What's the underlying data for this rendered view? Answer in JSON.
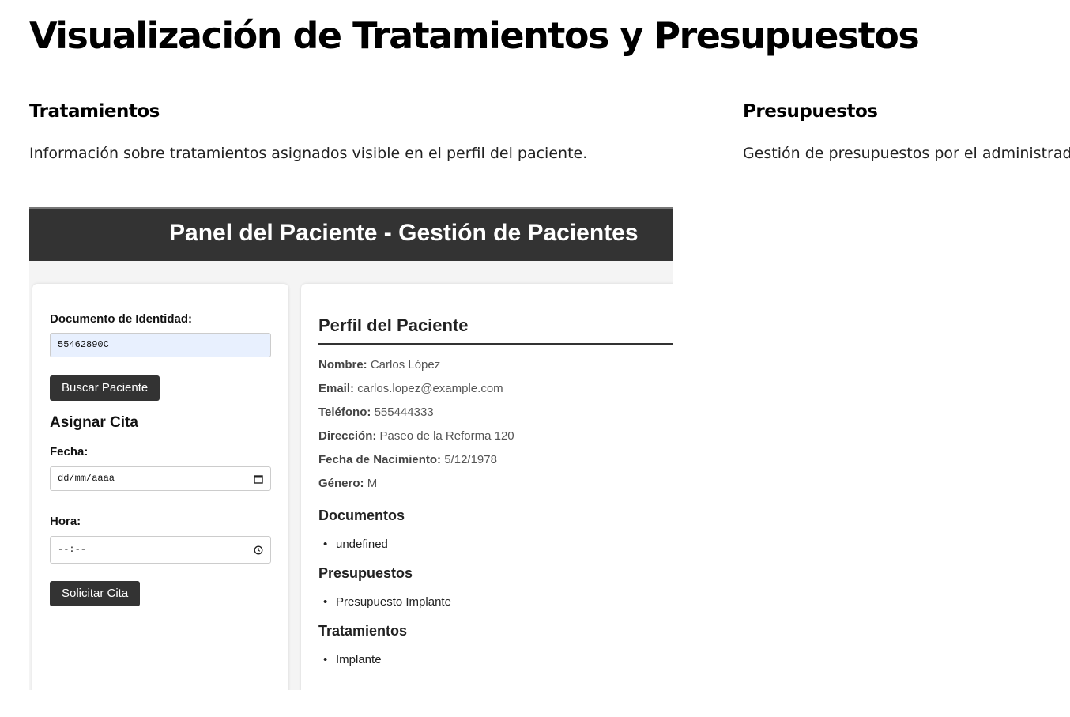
{
  "page": {
    "title": "Visualización de Tratamientos y Presupuestos"
  },
  "sections": {
    "tratamientos": {
      "title": "Tratamientos",
      "description": "Información sobre tratamientos asignados visible en el perfil del paciente."
    },
    "presupuestos": {
      "title": "Presupuestos",
      "description": "Gestión de presupuestos por el administrador,"
    }
  },
  "screenshot": {
    "header_title": "Panel del Paciente - Gestión de Pacientes",
    "search": {
      "label": "Documento de Identidad:",
      "value": "55462890C",
      "button": "Buscar Paciente"
    },
    "appointment": {
      "title": "Asignar Cita",
      "date_label": "Fecha:",
      "date_placeholder": "dd/mm/aaaa",
      "time_label": "Hora:",
      "time_placeholder": "--:--",
      "button": "Solicitar Cita"
    },
    "profile": {
      "title": "Perfil del Paciente",
      "fields": [
        {
          "label": "Nombre:",
          "value": "Carlos López"
        },
        {
          "label": "Email:",
          "value": "carlos.lopez@example.com"
        },
        {
          "label": "Teléfono:",
          "value": "555444333"
        },
        {
          "label": "Dirección:",
          "value": "Paseo de la Reforma 120"
        },
        {
          "label": "Fecha de Nacimiento:",
          "value": "5/12/1978"
        },
        {
          "label": "Género:",
          "value": "M"
        }
      ],
      "documents_title": "Documentos",
      "documents": [
        "undefined"
      ],
      "budgets_title": "Presupuestos",
      "budgets": [
        "Presupuesto Implante"
      ],
      "treatments_title": "Tratamientos",
      "treatments": [
        "Implante"
      ]
    }
  },
  "colors": {
    "header_bg": "#333333",
    "button_bg": "#333333",
    "filled_input_bg": "#e8f0fe"
  },
  "icons": {
    "date": "calendar-icon",
    "time": "clock-icon"
  }
}
